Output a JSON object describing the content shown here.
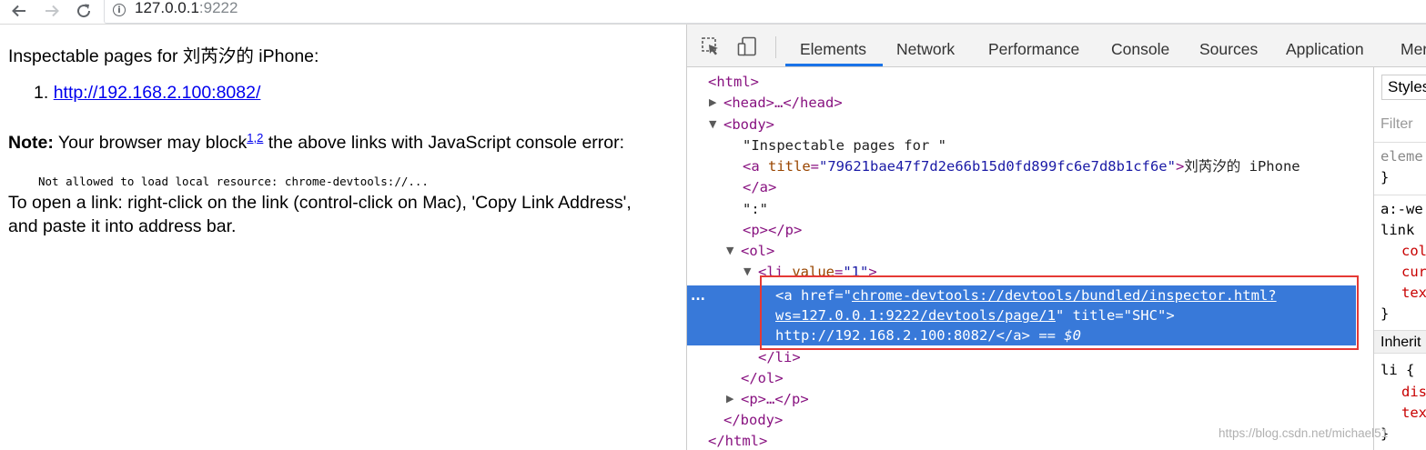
{
  "browser": {
    "back_icon": "arrow-left-icon",
    "forward_icon": "arrow-right-icon",
    "reload_icon": "reload-icon",
    "info_icon": "info-icon",
    "url_host": "127.0.0.1",
    "url_port": ":9222"
  },
  "page": {
    "title": "Inspectable pages for 刘芮汐的 iPhone:",
    "list_number": "1.",
    "link_text": "http://192.168.2.100:8082/",
    "note_label": "Note:",
    "note_text_before": " Your browser may block",
    "note_sup": "1,2",
    "note_text_after": " the above links with JavaScript console error:",
    "code_line": "Not allowed to load local resource: chrome-devtools://...",
    "instructions": "To open a link: right-click on the link (control-click on Mac), 'Copy Link Address', and paste it into address bar."
  },
  "devtools": {
    "inspect_icon": "cursor-select-icon",
    "device_icon": "device-toggle-icon",
    "tabs": [
      "Elements",
      "Network",
      "Performance",
      "Console",
      "Sources",
      "Application",
      "Mer"
    ],
    "active_tab": "Elements",
    "dom": {
      "html_open": "<html>",
      "head": "<head>…</head>",
      "body_open": "<body>",
      "text1": "\"Inspectable pages for \"",
      "a_open_tag": "<a ",
      "a_title_attr": "title",
      "a_title_val": "\"79621bae47f7d2e66b15d0fd899fc6e7d8b1cf6e\"",
      "a_close_bracket": ">",
      "a_text": "刘芮汐的 iPhone",
      "a_close": "</a>",
      "text2": "\":\"",
      "p_empty": "<p></p>",
      "ol_open": "<ol>",
      "li_open_tag": "<li ",
      "li_attr": "value",
      "li_val": "\"1\"",
      "li_bracket": ">",
      "sel_a_open": "<a ",
      "sel_href_attr": "href",
      "sel_href_val1": "chrome-devtools://devtools/bundled/inspector.html?",
      "sel_href_val2": "ws=127.0.0.1:9222/devtools/page/1",
      "sel_title_attr": "title",
      "sel_title_val": "\"SHC\"",
      "sel_text": "http://192.168.2.100:8082/",
      "sel_close": "</a>",
      "sel_eq": "== $0",
      "li_close": "</li>",
      "ol_close": "</ol>",
      "p_collapsed": "<p>…</p>",
      "body_close": "</body>",
      "html_close": "</html>",
      "ellipsis": "..."
    },
    "styles": {
      "tab": "Styles",
      "filter": "Filter",
      "element_style": "eleme",
      "brace_close": "}",
      "rule_selector": "a:-we",
      "rule_link": "link",
      "prop1": "col",
      "prop2": "cur",
      "prop3": "tex",
      "inherited": "Inherit",
      "li_rule": "li {",
      "prop4": "dis",
      "prop5": "tex"
    }
  },
  "watermark": "https://blog.csdn.net/michael51"
}
